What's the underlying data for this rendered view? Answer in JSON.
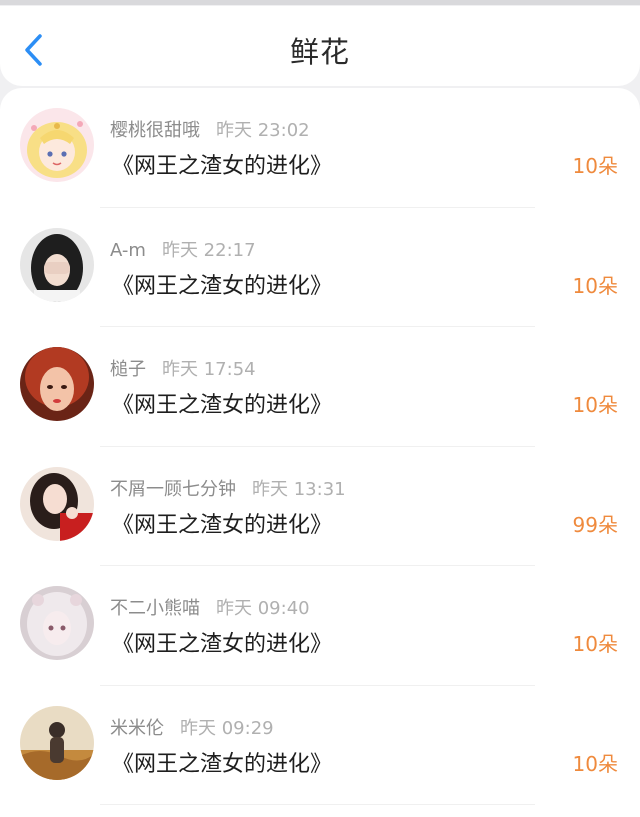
{
  "header": {
    "title": "鲜花"
  },
  "accent_color": "#2c8ef5",
  "amount_color": "#ef8a3d",
  "records": [
    {
      "username": "樱桃很甜哦",
      "time": "昨天 23:02",
      "book": "《网王之渣女的进化》",
      "amount": "10朵"
    },
    {
      "username": "A-m",
      "time": "昨天 22:17",
      "book": "《网王之渣女的进化》",
      "amount": "10朵"
    },
    {
      "username": "槌子",
      "time": "昨天 17:54",
      "book": "《网王之渣女的进化》",
      "amount": "10朵"
    },
    {
      "username": "不屑一顾七分钟",
      "time": "昨天 13:31",
      "book": "《网王之渣女的进化》",
      "amount": "99朵"
    },
    {
      "username": "不二小熊喵",
      "time": "昨天 09:40",
      "book": "《网王之渣女的进化》",
      "amount": "10朵"
    },
    {
      "username": "米米伦",
      "time": "昨天 09:29",
      "book": "《网王之渣女的进化》",
      "amount": "10朵"
    }
  ]
}
